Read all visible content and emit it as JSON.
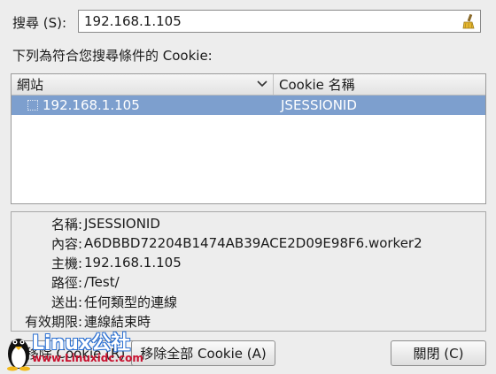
{
  "search": {
    "label": "搜尋 (S):",
    "value": "192.168.1.105"
  },
  "caption": "下列為符合您搜尋條件的 Cookie:",
  "list": {
    "columns": [
      "網站",
      "Cookie 名稱"
    ],
    "rows": [
      {
        "site": "192.168.1.105",
        "name": "JSESSIONID",
        "selected": true
      }
    ]
  },
  "details": [
    {
      "label": "名稱:",
      "value": "JSESSIONID"
    },
    {
      "label": "內容:",
      "value": "A6DBBD72204B1474AB39ACE2D09E98F6.worker2"
    },
    {
      "label": "主機:",
      "value": "192.168.1.105"
    },
    {
      "label": "路徑:",
      "value": "/Test/"
    },
    {
      "label": "送出:",
      "value": "任何類型的連線"
    },
    {
      "label": "有效期限:",
      "value": "連線結束時"
    }
  ],
  "buttons": {
    "remove": "移除 Cookie (R)",
    "remove_all": "移除全部 Cookie (A)",
    "close": "關閉 (C)"
  },
  "watermark": {
    "logo": "Linux公社",
    "url": "www.Linuxidc.com"
  },
  "colors": {
    "selection": "#7d9fce",
    "window_bg": "#ededed"
  }
}
